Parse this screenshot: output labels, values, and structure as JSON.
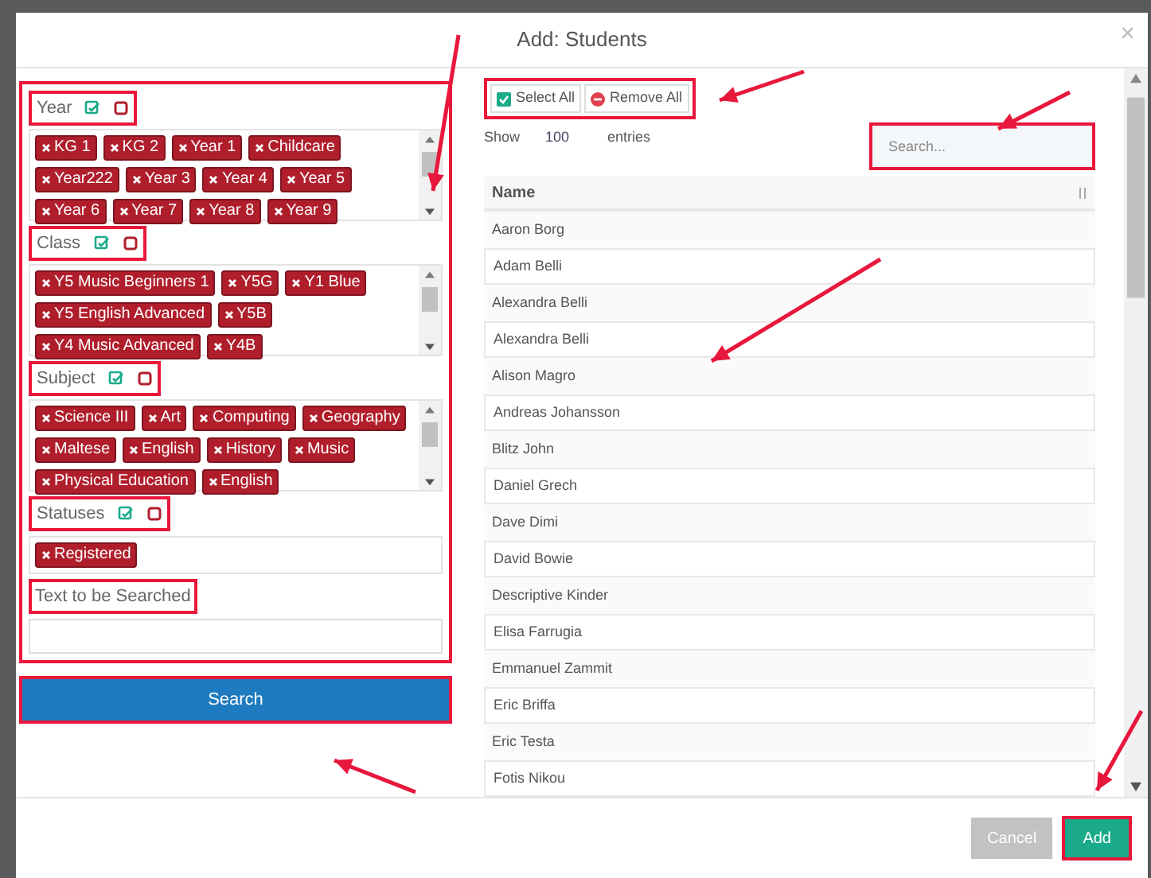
{
  "window": {
    "title": "Add: Students",
    "close": "×"
  },
  "filters": [
    {
      "label": "Year",
      "chips": [
        "KG 1",
        "KG 2",
        "Year 1",
        "Childcare",
        "Year222",
        "Year 3",
        "Year 4",
        "Year 5",
        "Year 6",
        "Year 7",
        "Year 8",
        "Year 9"
      ]
    },
    {
      "label": "Class",
      "chips": [
        "Y5 Music Beginners 1",
        "Y5G",
        "Y1 Blue",
        "Y5 English Advanced",
        "Y5B",
        "Y4 Music Advanced",
        "Y4B"
      ]
    },
    {
      "label": "Subject",
      "chips": [
        "Science III",
        "Art",
        "Computing",
        "Geography",
        "Maltese",
        "English",
        "History",
        "Music",
        "Physical Education",
        "English"
      ]
    }
  ],
  "statuses": {
    "label": "Statuses",
    "chips": [
      "Registered"
    ]
  },
  "text_search": {
    "label": "Text to be Searched"
  },
  "search_button": "Search",
  "toolbar": {
    "select_all": "Select All",
    "remove_all": "Remove All"
  },
  "show": {
    "prefix": "Show",
    "value": "100",
    "suffix": "entries"
  },
  "search_field": {
    "placeholder": "Search..."
  },
  "table": {
    "columns": [
      "Name"
    ],
    "rows": [
      "Aaron Borg",
      "Adam Belli",
      "Alexandra Belli",
      "Alexandra Belli",
      "Alison Magro",
      "Andreas Johansson",
      "Blitz John",
      "Daniel Grech",
      "Dave Dimi",
      "David Bowie",
      "Descriptive Kinder",
      "Elisa Farrugia",
      "Emmanuel Zammit",
      "Eric Briffa",
      "Eric Testa",
      "Fotis Nikou"
    ]
  },
  "footer": {
    "cancel": "Cancel",
    "add": "Add"
  }
}
